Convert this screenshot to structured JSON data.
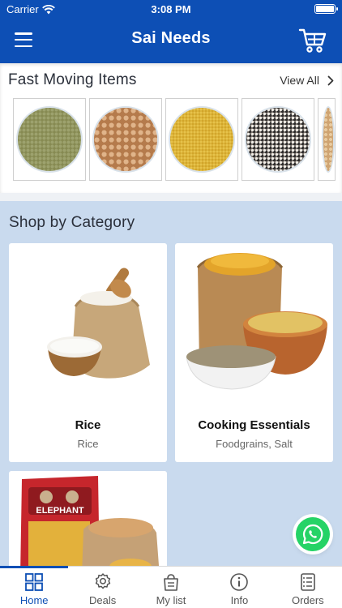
{
  "status": {
    "carrier": "Carrier",
    "time": "3:08 PM"
  },
  "header": {
    "title": "Sai Needs",
    "menu_icon": "hamburger-icon",
    "cart_icon": "cart-icon"
  },
  "fast_moving": {
    "title": "Fast Moving Items",
    "view_all": "View All",
    "items": [
      {
        "icon": "millet-grain-image"
      },
      {
        "icon": "chickpea-image"
      },
      {
        "icon": "yellow-millet-image"
      },
      {
        "icon": "mixed-seed-image"
      },
      {
        "icon": "partial-grain-image"
      }
    ]
  },
  "category": {
    "title": "Shop by Category",
    "cards": [
      {
        "name": "Rice",
        "sub": "Rice"
      },
      {
        "name": "Cooking Essentials",
        "sub": "Foodgrains, Salt"
      },
      {
        "name": "",
        "sub": ""
      }
    ],
    "bag_label": "ELEPHANT"
  },
  "tabs": [
    {
      "label": "Home",
      "icon": "grid-icon",
      "active": true
    },
    {
      "label": "Deals",
      "icon": "gear-badge-icon",
      "active": false
    },
    {
      "label": "My list",
      "icon": "shopping-bag-icon",
      "active": false
    },
    {
      "label": "Info",
      "icon": "info-icon",
      "active": false
    },
    {
      "label": "Orders",
      "icon": "orders-list-icon",
      "active": false
    }
  ],
  "colors": {
    "primary": "#0d4fb5",
    "category_bg": "#c9daee",
    "whatsapp": "#25d366"
  }
}
